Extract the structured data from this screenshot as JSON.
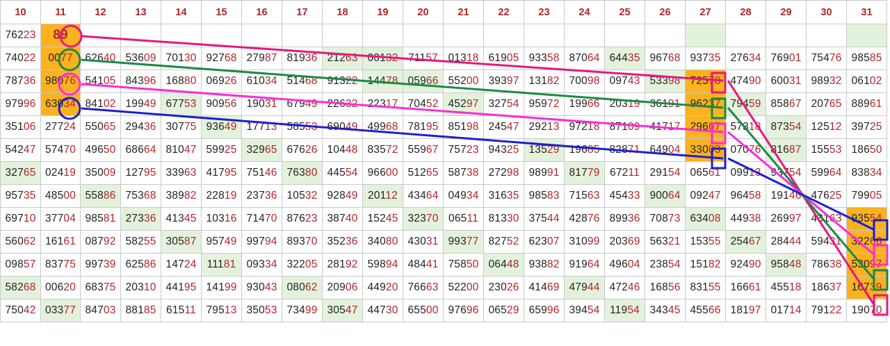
{
  "columns": [
    "10",
    "11",
    "12",
    "13",
    "14",
    "15",
    "16",
    "17",
    "18",
    "19",
    "20",
    "21",
    "22",
    "23",
    "24",
    "25",
    "26",
    "27",
    "28",
    "29",
    "30",
    "31"
  ],
  "rows": [
    [
      "76223",
      "89",
      "",
      "",
      "",
      "",
      "",
      "",
      "",
      "",
      "",
      "",
      "",
      "",
      "",
      "",
      "",
      "",
      "",
      "",
      "",
      ""
    ],
    [
      "74022",
      "0077",
      "62640",
      "53609",
      "70130",
      "92768",
      "27987",
      "81936",
      "21263",
      "00132",
      "71157",
      "01318",
      "61905",
      "93358",
      "87064",
      "64435",
      "96768",
      "93735",
      "27634",
      "76901",
      "75476",
      "98585"
    ],
    [
      "78736",
      "98076",
      "54105",
      "84396",
      "16880",
      "06926",
      "61034",
      "51468",
      "91322",
      "14478",
      "05966",
      "55200",
      "39397",
      "13182",
      "70098",
      "09743",
      "53398",
      "72578",
      "47490",
      "60031",
      "98932",
      "06102"
    ],
    [
      "97996",
      "63034",
      "84102",
      "19949",
      "67753",
      "90956",
      "19031",
      "67949",
      "22632",
      "22317",
      "70452",
      "45297",
      "32754",
      "95972",
      "19966",
      "20319",
      "36191",
      "96237",
      "79459",
      "85867",
      "20765",
      "88961"
    ],
    [
      "35106",
      "27724",
      "55065",
      "29436",
      "30775",
      "93649",
      "17713",
      "58553",
      "69049",
      "49968",
      "78195",
      "85198",
      "24547",
      "29213",
      "97218",
      "87109",
      "41717",
      "29667",
      "57318",
      "87354",
      "12512",
      "39725"
    ],
    [
      "54247",
      "57470",
      "49650",
      "68664",
      "81047",
      "59925",
      "32965",
      "67626",
      "10448",
      "83572",
      "55967",
      "75723",
      "94325",
      "13529",
      "19685",
      "82871",
      "64904",
      "33003",
      "07076",
      "81687",
      "15553",
      "18650"
    ],
    [
      "32765",
      "02419",
      "35009",
      "12795",
      "33963",
      "41795",
      "75146",
      "76380",
      "44554",
      "96600",
      "51265",
      "58738",
      "27298",
      "98991",
      "81779",
      "67211",
      "29154",
      "06561",
      "09913",
      "93754",
      "59964",
      "83834"
    ],
    [
      "95735",
      "48500",
      "55886",
      "75368",
      "38982",
      "22819",
      "23736",
      "10532",
      "92849",
      "20112",
      "43464",
      "04934",
      "31635",
      "98583",
      "71563",
      "45433",
      "90064",
      "09247",
      "96458",
      "19146",
      "47625",
      "79905"
    ],
    [
      "69710",
      "37704",
      "98581",
      "27336",
      "41345",
      "10316",
      "71470",
      "87623",
      "38740",
      "15245",
      "32370",
      "06511",
      "81330",
      "37544",
      "42876",
      "89936",
      "70873",
      "63408",
      "44938",
      "26997",
      "43163",
      "93554"
    ],
    [
      "56062",
      "16161",
      "08792",
      "58255",
      "30587",
      "95749",
      "99794",
      "89370",
      "35236",
      "34080",
      "43031",
      "99377",
      "82752",
      "62307",
      "31099",
      "20369",
      "56321",
      "15355",
      "25467",
      "28444",
      "59431",
      "32266"
    ],
    [
      "09857",
      "83775",
      "99739",
      "62586",
      "14724",
      "11181",
      "09334",
      "32205",
      "28192",
      "59894",
      "48441",
      "75850",
      "06448",
      "93882",
      "91964",
      "49604",
      "23854",
      "15182",
      "92490",
      "95848",
      "78638",
      "53097"
    ],
    [
      "58268",
      "00620",
      "68375",
      "20310",
      "44195",
      "14199",
      "93043",
      "08062",
      "20906",
      "44920",
      "76663",
      "52200",
      "23026",
      "41469",
      "47944",
      "47246",
      "16856",
      "83155",
      "16661",
      "45518",
      "18637",
      "16739"
    ],
    [
      "75042",
      "03377",
      "84703",
      "88185",
      "61511",
      "79513",
      "35053",
      "73499",
      "30547",
      "44730",
      "65500",
      "97696",
      "06529",
      "65996",
      "39454",
      "11954",
      "34345",
      "45566",
      "18197",
      "01714",
      "79122",
      "19070"
    ]
  ],
  "highlight_colors": {
    "orange": "#fbb21f",
    "light_green": "#e3f2dd",
    "digit_red": "#b0242a"
  },
  "line_colors": {
    "magenta_dark": "#e8167e",
    "green": "#1a8a44",
    "pink": "#ff2ad8",
    "blue": "#1d1fd0"
  }
}
